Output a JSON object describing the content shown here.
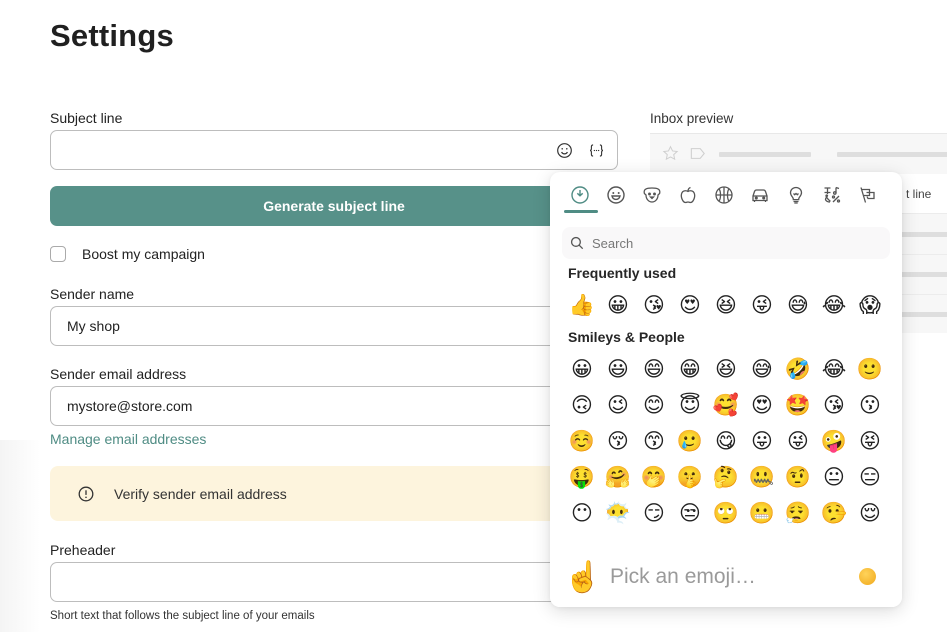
{
  "page": {
    "title": "Settings"
  },
  "form": {
    "subject": {
      "label": "Subject line",
      "value": "",
      "emoji_icon": "smiley-icon",
      "personalize_icon": "variable-braces-icon"
    },
    "generate_button": "Generate subject line",
    "boost": {
      "label": "Boost my campaign",
      "checked": false
    },
    "sender_name": {
      "label": "Sender name",
      "value": "My shop"
    },
    "sender_email": {
      "label": "Sender email address",
      "value": "mystore@store.com"
    },
    "manage_link": "Manage email addresses",
    "alert": {
      "icon": "exclamation-circle-icon",
      "text": "Verify sender email address"
    },
    "preheader": {
      "label": "Preheader",
      "value": "",
      "hint": "Short text that follows the subject line of your emails"
    }
  },
  "inbox_preview": {
    "label": "Inbox preview",
    "subject_fragment": "t line"
  },
  "emoji_picker": {
    "categories": [
      {
        "name": "frequently-used",
        "active": true
      },
      {
        "name": "smileys-people",
        "active": false
      },
      {
        "name": "animals-nature",
        "active": false
      },
      {
        "name": "food-drink",
        "active": false
      },
      {
        "name": "activity",
        "active": false
      },
      {
        "name": "travel-places",
        "active": false
      },
      {
        "name": "objects",
        "active": false
      },
      {
        "name": "symbols",
        "active": false
      },
      {
        "name": "flags",
        "active": false
      }
    ],
    "search_placeholder": "Search",
    "sections": [
      {
        "title": "Frequently used",
        "emojis": [
          "👍",
          "😀",
          "😘",
          "😍",
          "😆",
          "😜",
          "😅",
          "😂",
          "😱"
        ]
      },
      {
        "title": "Smileys & People",
        "emojis": [
          "😀",
          "😃",
          "😄",
          "😁",
          "😆",
          "😅",
          "🤣",
          "😂",
          "🙂",
          "🙃",
          "😉",
          "😊",
          "😇",
          "🥰",
          "😍",
          "🤩",
          "😘",
          "😗",
          "☺️",
          "😚",
          "😙",
          "🥲",
          "😋",
          "😛",
          "😜",
          "🤪",
          "😝",
          "🤑",
          "🤗",
          "🤭",
          "🤫",
          "🤔",
          "🤐",
          "🤨",
          "😐",
          "😑",
          "😶",
          "😶‍🌫️",
          "😏",
          "😒",
          "🙄",
          "😬",
          "😮‍💨",
          "🤥",
          "😌"
        ]
      }
    ],
    "footer": {
      "preview_emoji": "☝️",
      "placeholder": "Pick an emoji…",
      "skin_tone": "default-yellow"
    }
  }
}
